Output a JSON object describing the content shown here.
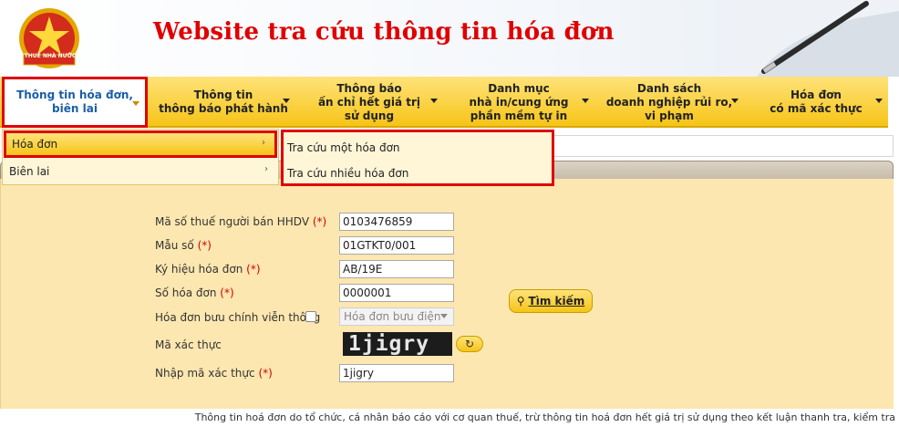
{
  "header": {
    "title": "Website tra cứu thông tin hóa đơn",
    "logo_text": "THUẾ NHÀ NƯỚC"
  },
  "nav": {
    "items": [
      {
        "label": "Thông tin hóa đơn,\nbiên lai"
      },
      {
        "label": "Thông tin\nthông báo phát hành"
      },
      {
        "label": "Thông báo\nấn chỉ hết giá trị\nsử dụng"
      },
      {
        "label": "Danh mục\nnhà in/cung ứng\nphần mềm tự in"
      },
      {
        "label": "Danh sách\ndoanh nghiệp rủi ro,\nvi phạm"
      },
      {
        "label": "Hóa đơn\ncó mã xác thực"
      }
    ]
  },
  "submenu": {
    "hoa_don": "Hóa đơn",
    "bien_lai": "Biên lai",
    "arrow": "›"
  },
  "flyout": {
    "item1": "Tra cứu một hóa đơn",
    "item2": "Tra cứu nhiều hóa đơn"
  },
  "form": {
    "mst_label": "Mã số thuế người bán HHDV",
    "mst_value": "0103476859",
    "mauso_label": "Mẫu số",
    "mauso_value": "01GTKT0/001",
    "kyhieu_label": "Ký hiệu hóa đơn",
    "kyhieu_value": "AB/19E",
    "sohd_label": "Số hóa đơn",
    "sohd_value": "0000001",
    "buuchinh_label": "Hóa đơn bưu chính viễn thông",
    "buuchinh_select": "Hóa đơn bưu điện",
    "maxacthuc_label": "Mã xác thực",
    "captcha_text": "1jigry",
    "nhap_label": "Nhập mã xác thực",
    "nhap_value": "1jigry",
    "required": "(*)",
    "refresh_icon": "↻"
  },
  "buttons": {
    "search_icon": "⚲",
    "search_label": "Tìm kiếm"
  },
  "footer": {
    "text": "Thông tin hoá đơn do tổ chức, cá nhân báo cáo với cơ quan thuế, trừ thông tin hoá đơn hết giá trị sử dụng theo kết luận thanh tra, kiểm tra"
  },
  "colors": {
    "accent_yellow": "#f6c417",
    "highlight_red": "#e00000",
    "panel_bg": "#fde7b0",
    "link_blue": "#1a5ea8"
  }
}
